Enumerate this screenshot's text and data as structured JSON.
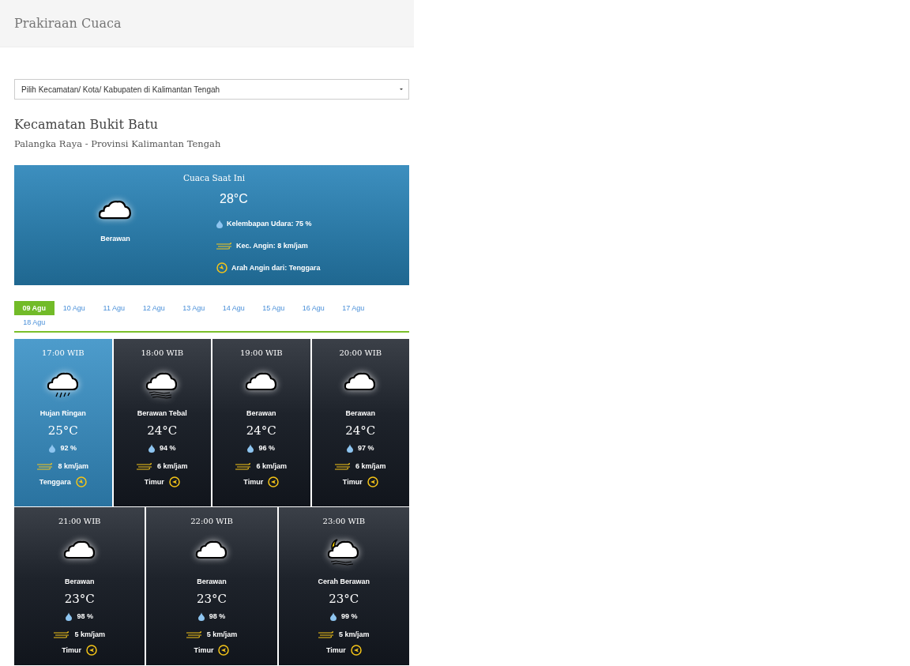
{
  "header": {
    "title": "Prakiraan Cuaca"
  },
  "select": {
    "placeholder": "Pilih Kecamatan/ Kota/ Kabupaten di Kalimantan Tengah"
  },
  "location": {
    "title": "Kecamatan Bukit Batu",
    "subtitle": "Palangka Raya - Provinsi Kalimantan Tengah"
  },
  "current": {
    "heading": "Cuaca Saat Ini",
    "kind": "cloud",
    "condition": "Berawan",
    "temperature": "28°C",
    "humidity": "Kelembapan Udara: 75 %",
    "wind_speed": "Kec. Angin: 8 km/jam",
    "wind_direction": {
      "label": "Arah Angin dari: Tenggara",
      "kind": "southeast"
    }
  },
  "date_tabs": [
    {
      "label": "09 Agu",
      "selected": true
    },
    {
      "label": "10 Agu",
      "selected": false
    },
    {
      "label": "11 Agu",
      "selected": false
    },
    {
      "label": "12 Agu",
      "selected": false
    },
    {
      "label": "13 Agu",
      "selected": false
    },
    {
      "label": "14 Agu",
      "selected": false
    },
    {
      "label": "15 Agu",
      "selected": false
    },
    {
      "label": "16 Agu",
      "selected": false
    },
    {
      "label": "17 Agu",
      "selected": false
    },
    {
      "label": "18 Agu",
      "selected": false
    }
  ],
  "forecast_rows": [
    [
      {
        "time": "17:00 WIB",
        "kind": "rain",
        "selected": true,
        "condition": "Hujan Ringan",
        "temperature": "25°C",
        "humidity": "92 %",
        "wind_speed": "8 km/jam",
        "direction": {
          "label": "Tenggara",
          "kind": "southeast"
        }
      },
      {
        "time": "18:00 WIB",
        "kind": "fog",
        "selected": false,
        "condition": "Berawan Tebal",
        "temperature": "24°C",
        "humidity": "94 %",
        "wind_speed": "6 km/jam",
        "direction": {
          "label": "Timur",
          "kind": "east"
        }
      },
      {
        "time": "19:00 WIB",
        "kind": "cloud",
        "selected": false,
        "condition": "Berawan",
        "temperature": "24°C",
        "humidity": "96 %",
        "wind_speed": "6 km/jam",
        "direction": {
          "label": "Timur",
          "kind": "east"
        }
      },
      {
        "time": "20:00 WIB",
        "kind": "cloud",
        "selected": false,
        "condition": "Berawan",
        "temperature": "24°C",
        "humidity": "97 %",
        "wind_speed": "6 km/jam",
        "direction": {
          "label": "Timur",
          "kind": "east"
        }
      }
    ],
    [
      {
        "time": "21:00 WIB",
        "kind": "cloud",
        "selected": false,
        "condition": "Berawan",
        "temperature": "23°C",
        "humidity": "98 %",
        "wind_speed": "5 km/jam",
        "direction": {
          "label": "Timur",
          "kind": "east"
        }
      },
      {
        "time": "22:00 WIB",
        "kind": "cloud",
        "selected": false,
        "condition": "Berawan",
        "temperature": "23°C",
        "humidity": "98 %",
        "wind_speed": "5 km/jam",
        "direction": {
          "label": "Timur",
          "kind": "east"
        }
      },
      {
        "time": "23:00 WIB",
        "kind": "moon",
        "selected": false,
        "condition": "Cerah Berawan",
        "temperature": "23°C",
        "humidity": "99 %",
        "wind_speed": "5 km/jam",
        "direction": {
          "label": "Timur",
          "kind": "east"
        }
      }
    ]
  ]
}
